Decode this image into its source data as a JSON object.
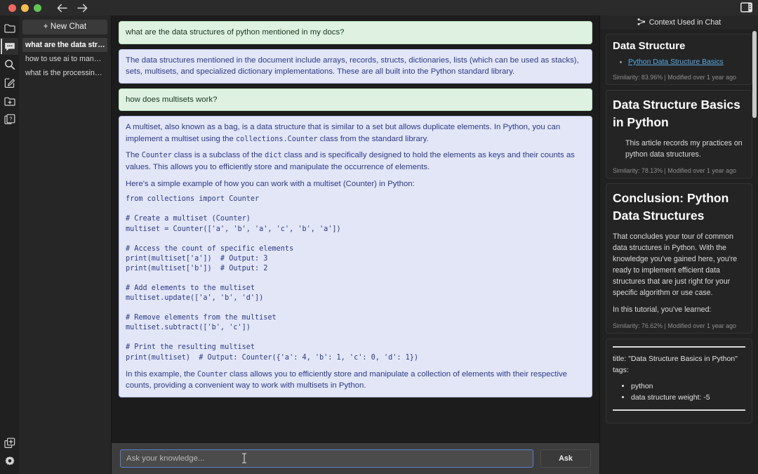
{
  "titlebar": {
    "back_label": "back-arrow",
    "forward_label": "forward-arrow",
    "panel_toggle_label": "toggle-right-panel"
  },
  "rail": {
    "items": [
      {
        "icon": "folder-icon",
        "name": "sidebar-item-files"
      },
      {
        "icon": "chat-bubble-icon",
        "name": "sidebar-item-chat"
      },
      {
        "icon": "search-icon",
        "name": "sidebar-item-search"
      },
      {
        "icon": "edit-square-icon",
        "name": "sidebar-item-edit"
      },
      {
        "icon": "folder-plus-icon",
        "name": "sidebar-item-new-folder"
      },
      {
        "icon": "docs-question-icon",
        "name": "sidebar-item-help-docs"
      }
    ],
    "bottom": [
      {
        "icon": "copy-plus-icon",
        "name": "sidebar-item-duplicate"
      },
      {
        "icon": "gear-icon",
        "name": "sidebar-item-settings"
      }
    ]
  },
  "chatlist": {
    "new_chat_label": "+ New Chat",
    "items": [
      {
        "label": "what are the data stru..."
      },
      {
        "label": "how to use ai to manag..."
      },
      {
        "label": "what is the processing ..."
      }
    ],
    "selected_index": 0
  },
  "conversation": {
    "messages": [
      {
        "role": "user",
        "paragraphs": [
          {
            "type": "text",
            "text": "what are the data structures of python mentioned in my docs?"
          }
        ]
      },
      {
        "role": "assistant",
        "paragraphs": [
          {
            "type": "text",
            "text": "The data structures mentioned in the document include arrays, records, structs, dictionaries, lists (which can be used as stacks), sets, multisets, and specialized dictionary implementations. These are all built into the Python standard library."
          }
        ]
      },
      {
        "role": "user",
        "paragraphs": [
          {
            "type": "text",
            "text": "how does multisets work?"
          }
        ]
      },
      {
        "role": "assistant",
        "paragraphs": [
          {
            "type": "html",
            "text": "A multiset, also known as a bag, is a data structure that is similar to a set but allows duplicate elements. In Python, you can implement a multiset using the <code>collections.Counter</code> class from the standard library."
          },
          {
            "type": "html",
            "text": "The <code>Counter</code> class is a subclass of the <code>dict</code> class and is specifically designed to hold the elements as keys and their counts as values. This allows you to efficiently store and manipulate the occurrence of elements."
          },
          {
            "type": "text",
            "text": "Here's a simple example of how you can work with a multiset (Counter) in Python:"
          },
          {
            "type": "code",
            "text": "from collections import Counter\n\n# Create a multiset (Counter)\nmultiset = Counter(['a', 'b', 'a', 'c', 'b', 'a'])\n\n# Access the count of specific elements\nprint(multiset['a'])  # Output: 3\nprint(multiset['b'])  # Output: 2\n\n# Add elements to the multiset\nmultiset.update(['a', 'b', 'd'])\n\n# Remove elements from the multiset\nmultiset.subtract(['b', 'c'])\n\n# Print the resulting multiset\nprint(multiset)  # Output: Counter({'a': 4, 'b': 1, 'c': 0, 'd': 1})"
          },
          {
            "type": "html",
            "text": "In this example, the <code>Counter</code> class allows you to efficiently store and manipulate a collection of elements with their respective counts, providing a convenient way to work with multisets in Python."
          }
        ]
      }
    ]
  },
  "composer": {
    "placeholder": "Ask your knowledge...",
    "value": "",
    "ask_label": "Ask"
  },
  "context_panel": {
    "header_title": "Context Used in Chat",
    "header_icon": "graph-network-icon",
    "cards": [
      {
        "kind": "link-card",
        "title": "Data Structure",
        "link": "Python Data Structure Basics",
        "meta": "Similarity: 83.96% | Modified over 1 year ago"
      },
      {
        "kind": "excerpt-card",
        "title": "Data Structure Basics in Python",
        "body": "This article records my practices on python data structures.",
        "meta": "Similarity: 78.13% | Modified over 1 year ago"
      },
      {
        "kind": "excerpt-card",
        "title": "Conclusion: Python Data Structures",
        "body": "That concludes your tour of common data structures in Python. With the knowledge you've gained here, you're ready to implement efficient data structures that are just right for your specific algorithm or use case.",
        "body2": "In this tutorial, you've learned:",
        "meta": "Similarity: 76.62% | Modified over 1 year ago"
      },
      {
        "kind": "frontmatter-card",
        "title_line": "title: \"Data Structure Basics in Python\"",
        "tags_label": "tags:",
        "tags": [
          "python",
          "data structure weight: -5"
        ]
      }
    ]
  },
  "colors": {
    "user_bubble": "#dff2e1",
    "assistant_bubble": "#e3e6f7",
    "assistant_text": "#2b3a86",
    "accent_input_border": "#5b7fd0",
    "link": "#5aa9e6",
    "app_bg": "#1e1e1e"
  }
}
